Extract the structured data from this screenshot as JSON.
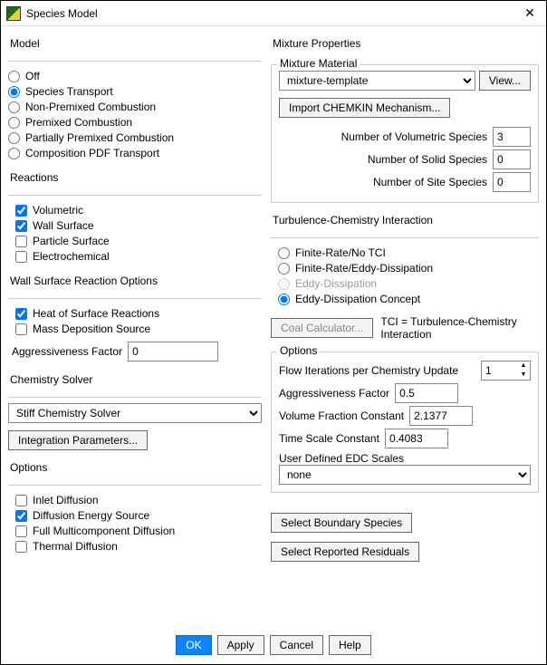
{
  "window": {
    "title": "Species Model",
    "close": "✕"
  },
  "model": {
    "heading": "Model",
    "options": [
      "Off",
      "Species Transport",
      "Non-Premixed Combustion",
      "Premixed Combustion",
      "Partially Premixed Combustion",
      "Composition PDF Transport"
    ],
    "selected": 1
  },
  "reactions": {
    "heading": "Reactions",
    "items": [
      {
        "label": "Volumetric",
        "checked": true
      },
      {
        "label": "Wall Surface",
        "checked": true
      },
      {
        "label": "Particle Surface",
        "checked": false
      },
      {
        "label": "Electrochemical",
        "checked": false
      }
    ]
  },
  "wallSurface": {
    "heading": "Wall Surface Reaction Options",
    "items": [
      {
        "label": "Heat of Surface Reactions",
        "checked": true
      },
      {
        "label": "Mass Deposition Source",
        "checked": false
      }
    ],
    "aggLabel": "Aggressiveness Factor",
    "aggValue": "0"
  },
  "chemSolver": {
    "heading": "Chemistry Solver",
    "value": "Stiff Chemistry Solver",
    "btn": "Integration Parameters..."
  },
  "leftOptions": {
    "heading": "Options",
    "items": [
      {
        "label": "Inlet Diffusion",
        "checked": false
      },
      {
        "label": "Diffusion Energy Source",
        "checked": true
      },
      {
        "label": "Full Multicomponent Diffusion",
        "checked": false
      },
      {
        "label": "Thermal Diffusion",
        "checked": false
      }
    ]
  },
  "mixture": {
    "heading": "Mixture Properties",
    "matLabel": "Mixture Material",
    "matValue": "mixture-template",
    "viewBtn": "View...",
    "importBtn": "Import CHEMKIN Mechanism...",
    "volLabel": "Number of Volumetric Species",
    "volValue": "3",
    "solLabel": "Number of Solid Species",
    "solValue": "0",
    "siteLabel": "Number of Site Species",
    "siteValue": "0"
  },
  "tci": {
    "heading": "Turbulence-Chemistry Interaction",
    "options": [
      {
        "label": "Finite-Rate/No TCI",
        "enabled": true
      },
      {
        "label": "Finite-Rate/Eddy-Dissipation",
        "enabled": true
      },
      {
        "label": "Eddy-Dissipation",
        "enabled": false
      },
      {
        "label": "Eddy-Dissipation Concept",
        "enabled": true
      }
    ],
    "selected": 3,
    "coalBtn": "Coal Calculator...",
    "tciNote": "TCI = Turbulence-Chemistry Interaction"
  },
  "edcOptions": {
    "heading": "Options",
    "flowLabel": "Flow Iterations per Chemistry Update",
    "flowValue": "1",
    "aggLabel": "Aggressiveness Factor",
    "aggValue": "0.5",
    "volFracLabel": "Volume Fraction Constant",
    "volFracValue": "2.1377",
    "timeLabel": "Time Scale Constant",
    "timeValue": "0.4083",
    "userLabel": "User Defined EDC Scales",
    "userValue": "none"
  },
  "rightButtons": {
    "boundary": "Select Boundary Species",
    "residuals": "Select Reported Residuals"
  },
  "footer": {
    "ok": "OK",
    "apply": "Apply",
    "cancel": "Cancel",
    "help": "Help"
  }
}
